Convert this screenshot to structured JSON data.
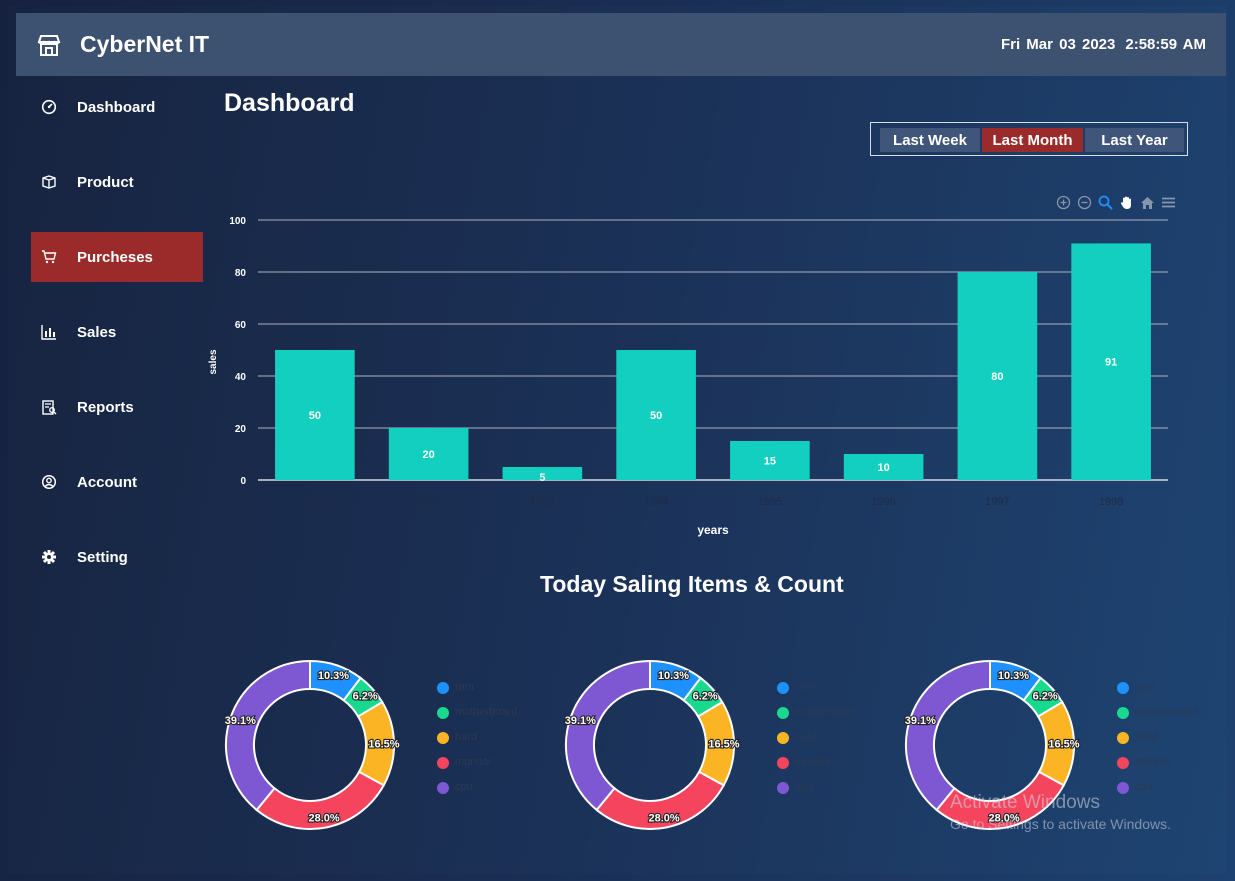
{
  "app": {
    "brand": "CyberNet IT",
    "date": "Fri Mar 03 2023",
    "time": "2:58:59 AM"
  },
  "sidebar": {
    "items": [
      {
        "label": "Dashboard",
        "icon": "speedometer-icon",
        "active": false
      },
      {
        "label": "Product",
        "icon": "box-icon",
        "active": false
      },
      {
        "label": "Purcheses",
        "icon": "cart-icon",
        "active": true
      },
      {
        "label": "Sales",
        "icon": "bar-chart-icon",
        "active": false
      },
      {
        "label": "Reports",
        "icon": "report-icon",
        "active": false
      },
      {
        "label": "Account",
        "icon": "user-circle-icon",
        "active": false
      },
      {
        "label": "Setting",
        "icon": "gear-icon",
        "active": false
      }
    ]
  },
  "main": {
    "title": "Dashboard",
    "range": {
      "buttons": [
        "Last Week",
        "Last Month",
        "Last Year"
      ],
      "selected": "Last Month"
    },
    "chart_toolbar": [
      "zoom-in-icon",
      "zoom-out-icon",
      "selection-zoom-icon",
      "pan-hand-icon",
      "home-reset-icon",
      "menu-icon"
    ],
    "pie_section_title": "Today Saling Items & Count"
  },
  "colors": {
    "bar": "#12cfbf",
    "accent_active": "#9b2b2b",
    "topbar": "#3d5170",
    "slice_ram": "#1e90ff",
    "slice_motherboard": "#19d98f",
    "slice_hard": "#fbb524",
    "slice_monitor": "#f5445e",
    "slice_cpu": "#7e57d3"
  },
  "chart_data": [
    {
      "type": "bar",
      "categories": [
        "1991",
        "1992",
        "1993",
        "1994",
        "1995",
        "1996",
        "1997",
        "1998"
      ],
      "values": [
        50,
        20,
        5,
        50,
        15,
        10,
        80,
        91
      ],
      "xlabel": "years",
      "ylabel": "sales",
      "ylim": [
        0,
        100
      ],
      "yticks": [
        0,
        20,
        40,
        60,
        80,
        100
      ],
      "grid": true,
      "data_labels": true
    },
    {
      "type": "pie",
      "donut": true,
      "labels": [
        "ram",
        "motherboard",
        "hard",
        "monitor",
        "cpu"
      ],
      "values": [
        10.3,
        6.2,
        16.5,
        28.0,
        39.1
      ],
      "value_labels": [
        "10.3%",
        "6.2%",
        "16.5%",
        "28.0%",
        "39.1%"
      ],
      "legend": "right"
    },
    {
      "type": "pie",
      "donut": true,
      "labels": [
        "ram",
        "motherboard",
        "hard",
        "monitor",
        "cpu"
      ],
      "values": [
        10.3,
        6.2,
        16.5,
        28.0,
        39.1
      ],
      "value_labels": [
        "10.3%",
        "6.2%",
        "16.5%",
        "28.0%",
        "39.1%"
      ],
      "legend": "right"
    },
    {
      "type": "pie",
      "donut": true,
      "labels": [
        "ram",
        "motherboard",
        "hard",
        "monitor",
        "cpu"
      ],
      "values": [
        10.3,
        6.2,
        16.5,
        28.0,
        39.1
      ],
      "value_labels": [
        "10.3%",
        "6.2%",
        "16.5%",
        "28.0%",
        "39.1%"
      ],
      "legend": "right"
    }
  ],
  "watermark": {
    "title": "Activate Windows",
    "subtitle": "Go to Settings to activate Windows."
  }
}
